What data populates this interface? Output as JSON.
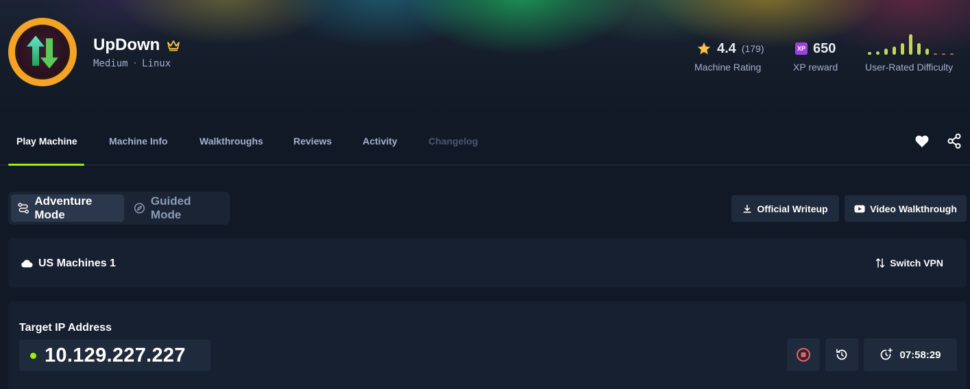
{
  "machine": {
    "name": "UpDown",
    "difficulty": "Medium",
    "os": "Linux",
    "separator": "·"
  },
  "stats": {
    "rating": "4.4",
    "rating_count": "(179)",
    "rating_label": "Machine Rating",
    "xp_badge": "XP",
    "xp_value": "650",
    "xp_label": "XP reward",
    "difficulty_label": "User-Rated Difficulty",
    "difficulty_distribution": [
      0.12,
      0.18,
      0.3,
      0.4,
      0.55,
      1.0,
      0.55,
      0.3,
      0.06,
      0.06,
      0.06
    ]
  },
  "tabs": [
    {
      "label": "Play Machine",
      "state": "active"
    },
    {
      "label": "Machine Info",
      "state": "normal"
    },
    {
      "label": "Walkthroughs",
      "state": "normal"
    },
    {
      "label": "Reviews",
      "state": "normal"
    },
    {
      "label": "Activity",
      "state": "normal"
    },
    {
      "label": "Changelog",
      "state": "disabled"
    }
  ],
  "modes": {
    "adventure": "Adventure Mode",
    "guided": "Guided Mode"
  },
  "actions": {
    "writeup": "Official Writeup",
    "video": "Video Walkthrough"
  },
  "vpn": {
    "server": "US Machines 1",
    "switch_label": "Switch VPN"
  },
  "target": {
    "label": "Target IP Address",
    "ip": "10.129.227.227",
    "timer": "07:58:29"
  },
  "colors": {
    "accent": "#9fef00",
    "logo_ring": "#f5a324",
    "star": "#f6c343",
    "stop": "#ff5a5a",
    "xp": "#9f3fe0"
  },
  "icons": [
    "crown-icon",
    "star-icon",
    "heart-icon",
    "share-icon",
    "route-icon",
    "compass-icon",
    "download-icon",
    "youtube-icon",
    "cloud-icon",
    "switch-arrows-icon",
    "stop-icon",
    "reset-icon",
    "timer-plus-icon"
  ]
}
